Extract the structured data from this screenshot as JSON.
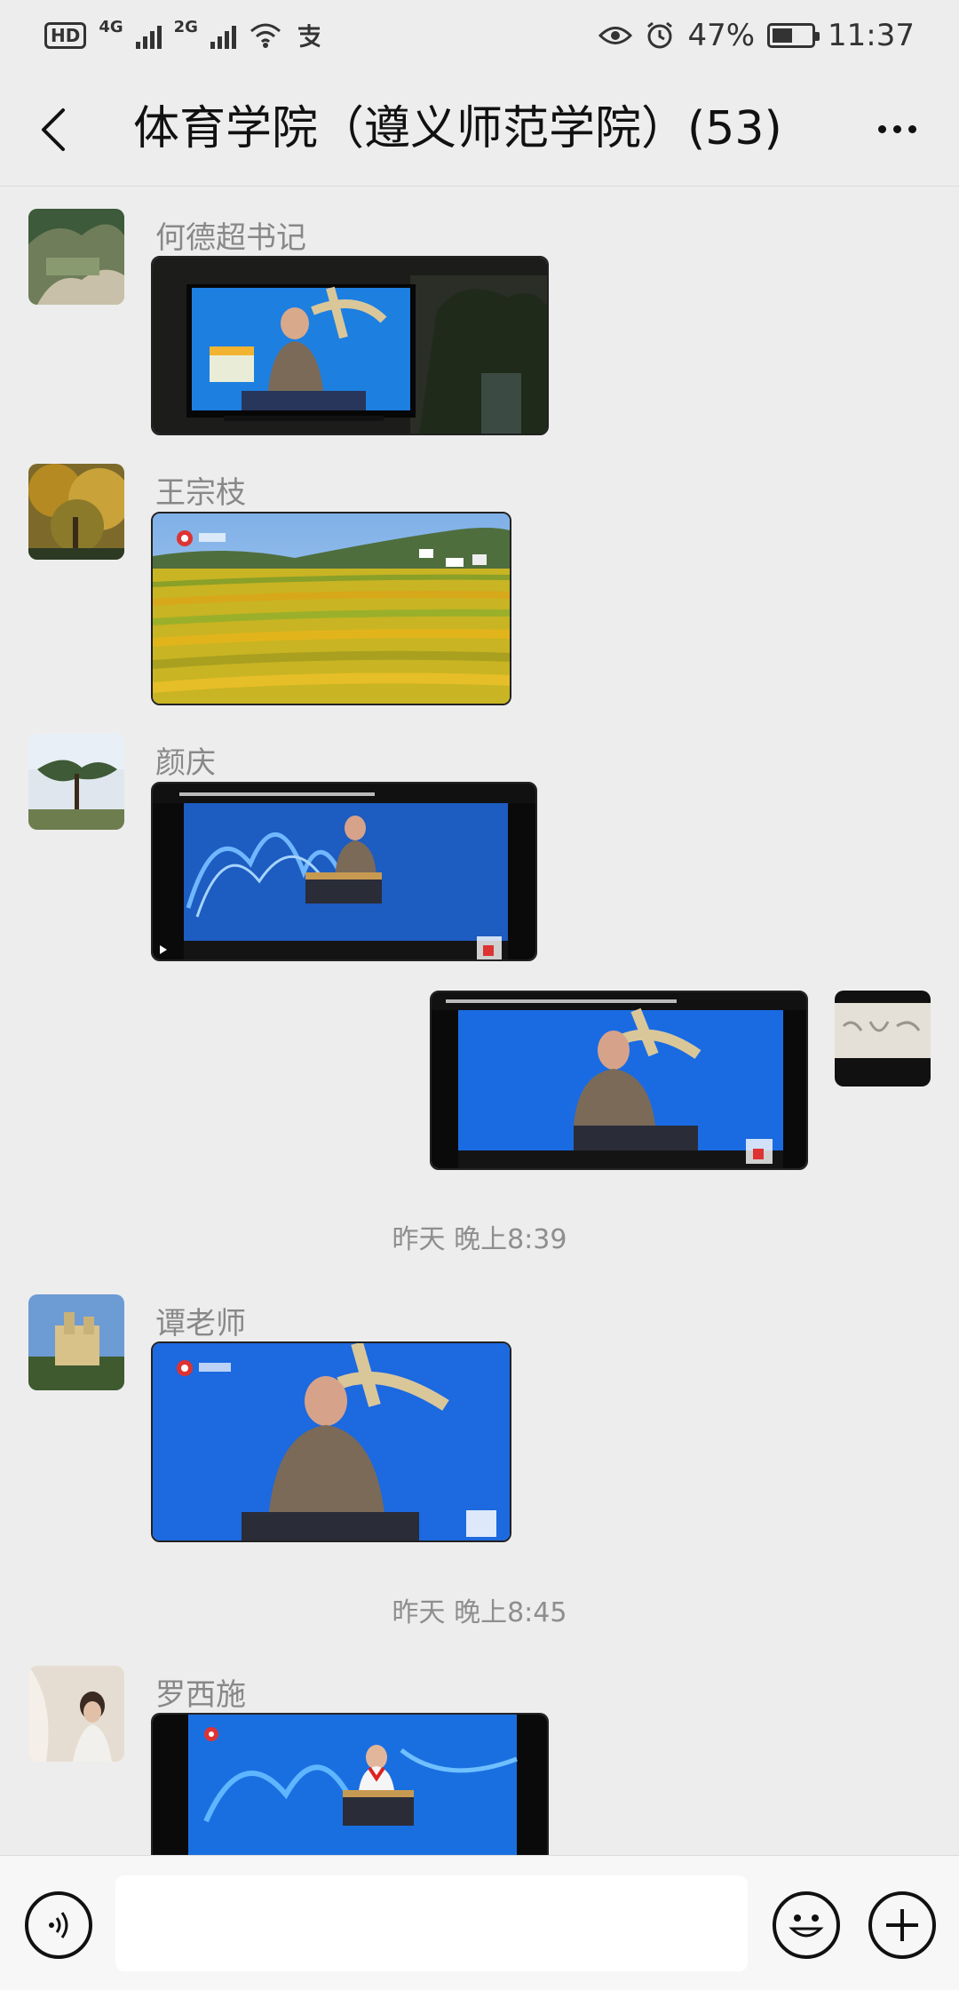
{
  "status_bar": {
    "hd": "HD",
    "network_a": "4G",
    "network_b": "2G",
    "battery_percent": "47%",
    "time": "11:37",
    "battery_level": 0.47
  },
  "header": {
    "title": "体育学院（遵义师范学院）(53)",
    "back_icon": "chevron-left-icon",
    "more_icon": "more-dots-icon"
  },
  "messages": [
    {
      "sender": "何德超书记",
      "type": "image",
      "content": "tv-screen-speaker-photo"
    },
    {
      "sender": "王宗枝",
      "type": "image",
      "content": "rice-terrace-photo"
    },
    {
      "sender": "颜庆",
      "type": "image",
      "content": "video-screenshot-podium"
    },
    {
      "sender": "self",
      "type": "image",
      "content": "video-screenshot-podium"
    },
    {
      "sender": "谭老师",
      "type": "image",
      "content": "speaker-podium-photo"
    },
    {
      "sender": "罗西施",
      "type": "image",
      "content": "girl-podium-photo"
    }
  ],
  "timestamps": [
    "昨天 晚上8:39",
    "昨天 晚上8:45"
  ],
  "input_bar": {
    "placeholder": "",
    "voice_icon": "voice-icon",
    "emoji_icon": "emoji-icon",
    "plus_icon": "plus-icon"
  },
  "colors": {
    "background": "#ededed",
    "header_text": "#111111",
    "sender_text": "#888888",
    "timestamp_text": "#8e8e8e",
    "input_bar_bg": "#f7f7f7"
  }
}
